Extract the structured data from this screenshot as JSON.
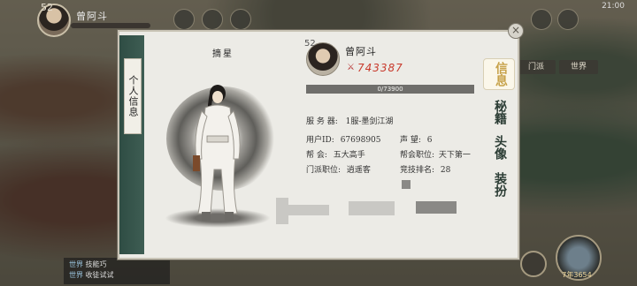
{
  "hud": {
    "level": "52",
    "name": "曾阿斗"
  },
  "status": {
    "time": "21:00"
  },
  "right_pills": [
    "门派",
    "世界"
  ],
  "chat": [
    {
      "channel": "世界",
      "text": "技能巧"
    },
    {
      "channel": "世界",
      "text": "收徒试试"
    }
  ],
  "main_button": {
    "label": "7年3654"
  },
  "panel": {
    "left_tab": "个人信息",
    "character_title": "摘星",
    "profile": {
      "level": "52",
      "name": "曾阿斗",
      "power": "743387",
      "exp_text": "0/73900",
      "exp_fraction": 0.0
    },
    "info": {
      "server_label": "服 务 器:",
      "server_value": "1服-墨剑江湖",
      "user_id_label": "用户ID:",
      "user_id_value": "67698905",
      "fame_label": "声   望:",
      "fame_value": "6",
      "guild_label": "帮    会:",
      "guild_value": "五大高手",
      "guild_role_label": "帮会职位:",
      "guild_role_value": "天下第一",
      "sect_role_label": "门派职位:",
      "sect_role_value": "逍遥客",
      "arena_label": "竞技排名:",
      "arena_value": "28"
    },
    "right_tabs": [
      "信息",
      "秘籍",
      "头像",
      "装扮"
    ],
    "active_tab": "信息"
  },
  "colors": {
    "accent_green": "#2f4d44",
    "power_red": "#c83a2c",
    "active_gold": "#c7a24a"
  }
}
